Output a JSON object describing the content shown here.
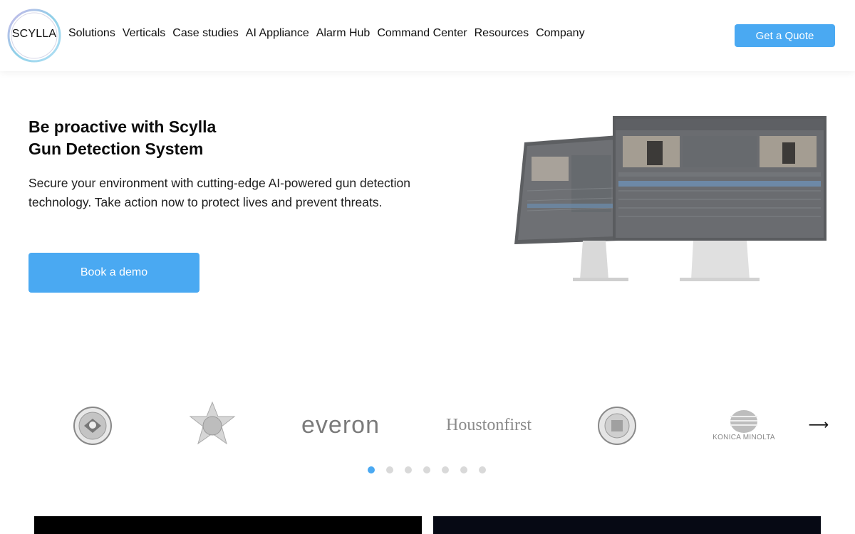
{
  "header": {
    "logo_text": "SCYLLA",
    "nav": [
      "Solutions",
      "Verticals",
      "Case studies",
      "AI Appliance",
      "Alarm Hub",
      "Command Center",
      "Resources",
      "Company"
    ],
    "quote_label": "Get a Quote"
  },
  "hero": {
    "title_line1": "Be proactive with Scylla",
    "title_line2": "Gun Detection System",
    "subtitle": "Secure your environment with cutting-edge AI-powered gun detection technology. Take action now to protect lives and prevent threats.",
    "demo_label": "Book a demo"
  },
  "clients": {
    "everon": "everon",
    "houston": "Houstonfirst",
    "konica": "KONICA MINOLTA"
  },
  "carousel": {
    "dot_count": 7,
    "active_index": 0
  },
  "colors": {
    "accent": "#4aa9f2"
  }
}
